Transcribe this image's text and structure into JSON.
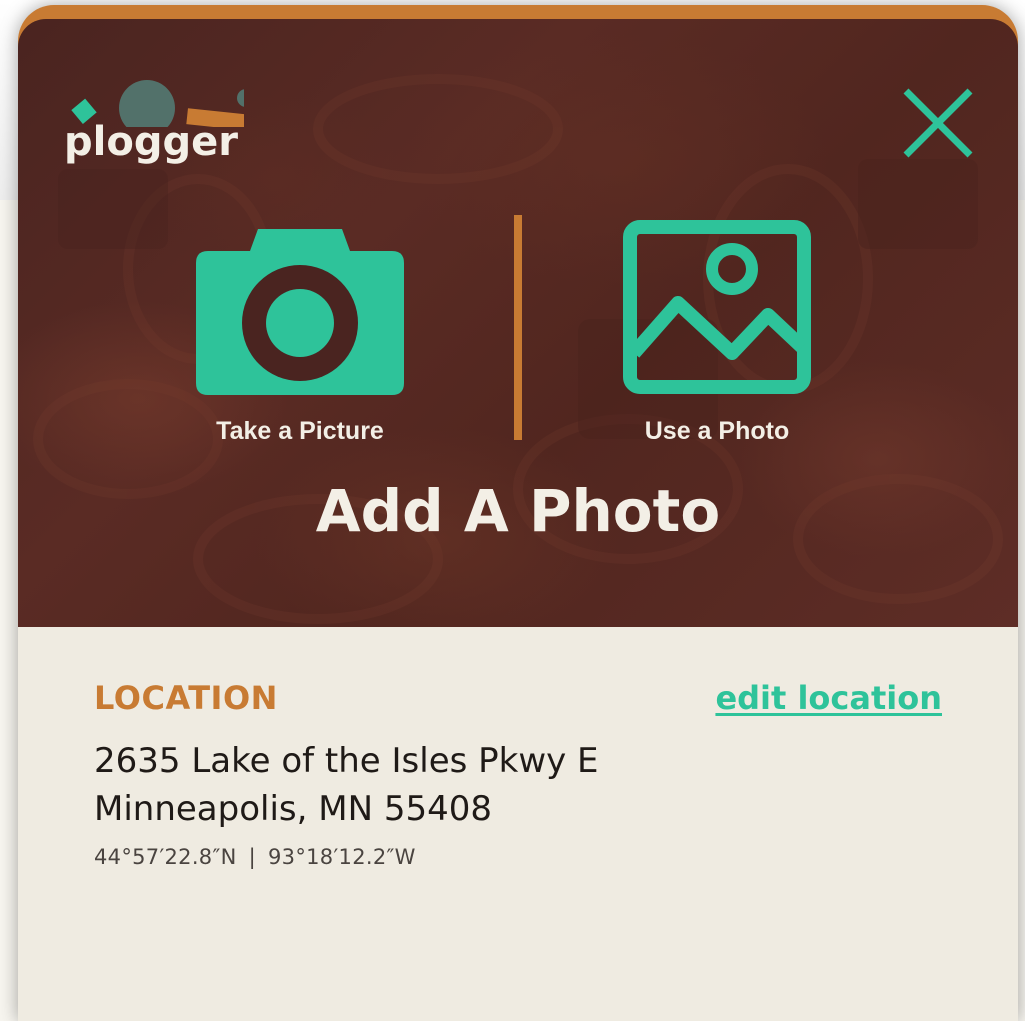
{
  "app": {
    "logo_text": "plogger"
  },
  "hero": {
    "title": "Add A Photo",
    "options": [
      {
        "label": "Take a Picture",
        "icon": "camera-icon"
      },
      {
        "label": "Use a Photo",
        "icon": "image-icon"
      }
    ],
    "close_icon": "close-icon"
  },
  "location": {
    "label": "LOCATION",
    "edit_label": "edit location",
    "address_line1": "2635 Lake of the Isles Pkwy E",
    "address_line2": "Minneapolis, MN 55408",
    "latitude": "44°57′22.8″N",
    "separator": "|",
    "longitude": "93°18′12.2″W"
  },
  "colors": {
    "accent_green": "#2ec39a",
    "accent_orange": "#c87b33",
    "hero_bg": "#4f2621",
    "info_bg": "#efebe1",
    "text_light": "#f3efe6"
  }
}
